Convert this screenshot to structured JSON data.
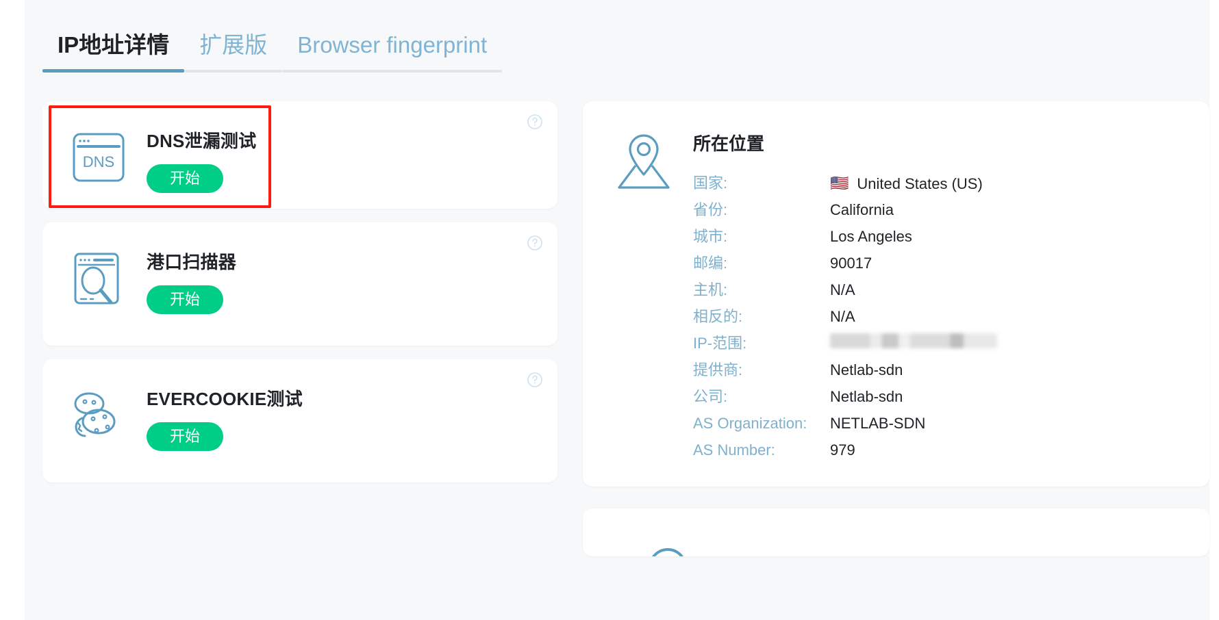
{
  "tabs": [
    {
      "label": "IP地址详情",
      "active": true
    },
    {
      "label": "扩展版",
      "active": false
    },
    {
      "label": "Browser fingerprint",
      "active": false
    }
  ],
  "tools": [
    {
      "title": "DNS泄漏测试",
      "icon": "dns-browser-icon",
      "icon_label": "DNS",
      "button_label": "开始",
      "help_icon": "help-circle-icon",
      "highlighted": true
    },
    {
      "title": "港口扫描器",
      "icon": "port-scanner-icon",
      "icon_label": "",
      "button_label": "开始",
      "help_icon": "help-circle-icon",
      "highlighted": false
    },
    {
      "title": "EVERCOOKIE测试",
      "icon": "cookie-stack-icon",
      "icon_label": "",
      "button_label": "开始",
      "help_icon": "help-circle-icon",
      "highlighted": false
    }
  ],
  "location": {
    "icon": "map-pin-icon",
    "heading": "所在位置",
    "rows": [
      {
        "label": "国家:",
        "value": "United States (US)",
        "flag": "🇺🇸",
        "redacted": false
      },
      {
        "label": "省份:",
        "value": "California",
        "flag": "",
        "redacted": false
      },
      {
        "label": "城市:",
        "value": "Los Angeles",
        "flag": "",
        "redacted": false
      },
      {
        "label": "邮编:",
        "value": "90017",
        "flag": "",
        "redacted": false
      },
      {
        "label": "主机:",
        "value": "N/A",
        "flag": "",
        "redacted": false
      },
      {
        "label": "相反的:",
        "value": "N/A",
        "flag": "",
        "redacted": false
      },
      {
        "label": "IP-范围:",
        "value": "",
        "flag": "",
        "redacted": true
      },
      {
        "label": "提供商:",
        "value": "Netlab-sdn",
        "flag": "",
        "redacted": false
      },
      {
        "label": "公司:",
        "value": "Netlab-sdn",
        "flag": "",
        "redacted": false
      },
      {
        "label": "AS Organization:",
        "value": "NETLAB-SDN",
        "flag": "",
        "redacted": false
      },
      {
        "label": "AS Number:",
        "value": "979",
        "flag": "",
        "redacted": false
      }
    ]
  },
  "colors": {
    "page_bg": "#f7f8f9",
    "card_bg": "#ffffff",
    "accent_blue": "#5a9dc0",
    "label_blue": "#7fb0cc",
    "button_green": "#00ce87",
    "highlight_red": "#ff1a12",
    "text_dark": "#1f2327"
  }
}
